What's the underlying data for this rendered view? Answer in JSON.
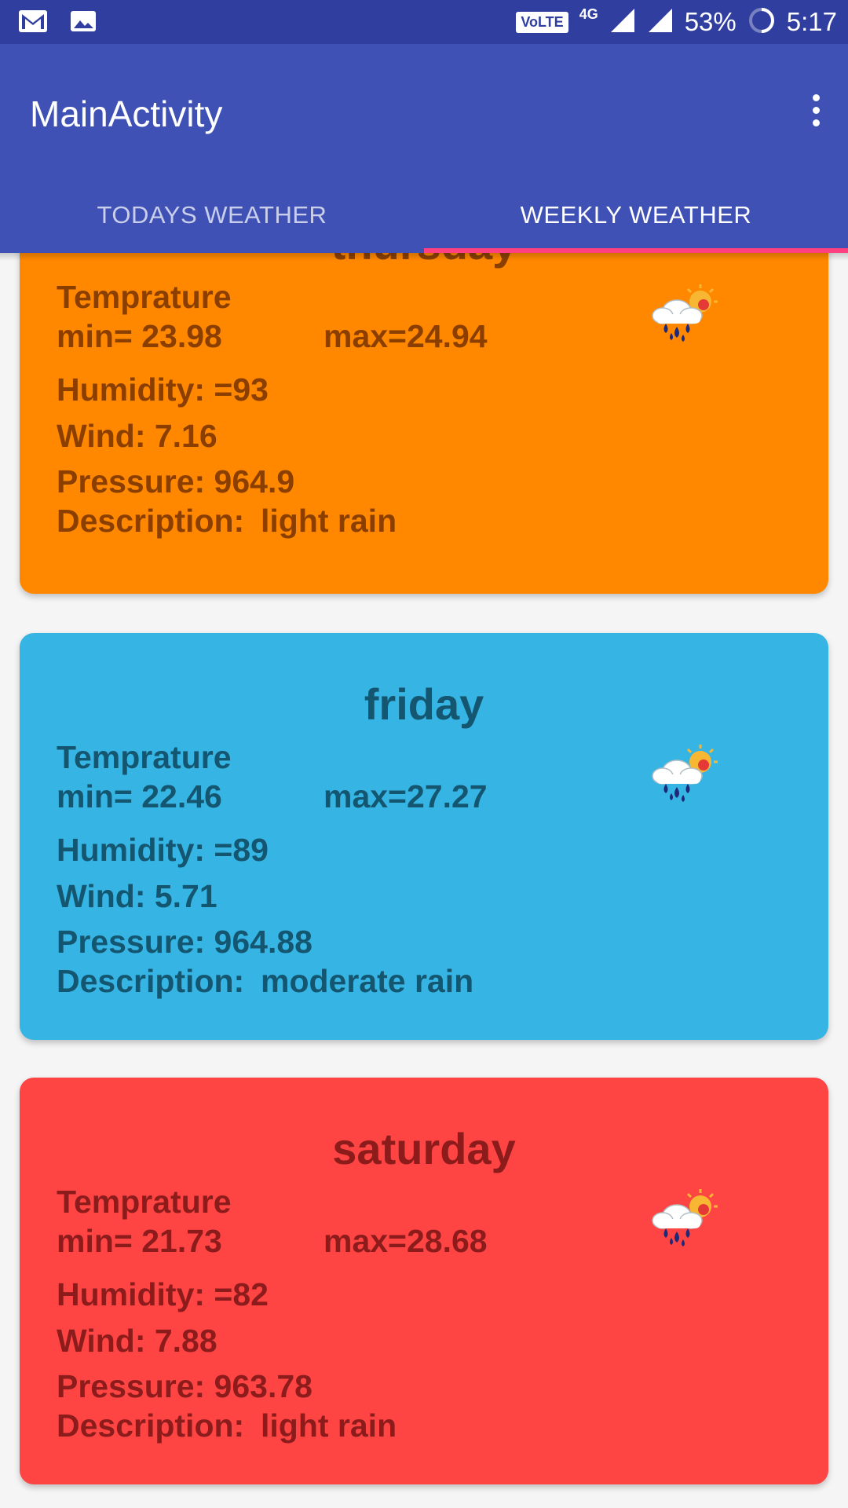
{
  "status_bar": {
    "icons": [
      "gmail-icon",
      "image-icon",
      "volte-icon",
      "signal-icon",
      "battery-ring-icon"
    ],
    "volte": "VoLTE",
    "network": "4G",
    "battery": "53%",
    "time": "5:17"
  },
  "app_bar": {
    "title": "MainActivity",
    "menu_icon": "more-vert-icon"
  },
  "tabs": [
    {
      "label": "TODAYS WEATHER",
      "selected": false
    },
    {
      "label": "WEEKLY WEATHER",
      "selected": true
    }
  ],
  "colors": {
    "status_bar": "#303F9F",
    "app_bar": "#3F51B5",
    "tab_indicator": "#FF4081"
  },
  "forecast": [
    {
      "day": "thursday",
      "temp_label": "Temprature",
      "min": "min= 23.98",
      "max": "max=24.94",
      "humidity": "Humidity: =93",
      "wind": "Wind: 7.16",
      "pressure": "Pressure: 964.9",
      "desc_label": "Description:",
      "desc_value": "light rain",
      "icon": "rain-cloud-sun-icon",
      "bg": "#FF8800",
      "fg": "#8A3F00"
    },
    {
      "day": "friday",
      "temp_label": "Temprature",
      "min": "min= 22.46",
      "max": "max=27.27",
      "humidity": "Humidity: =89",
      "wind": "Wind: 5.71",
      "pressure": "Pressure: 964.88",
      "desc_label": "Description:",
      "desc_value": "moderate rain",
      "icon": "rain-cloud-sun-icon",
      "bg": "#36B5E5",
      "fg": "#145670"
    },
    {
      "day": "saturday",
      "temp_label": "Temprature",
      "min": "min= 21.73",
      "max": "max=28.68",
      "humidity": "Humidity: =82",
      "wind": "Wind: 7.88",
      "pressure": "Pressure: 963.78",
      "desc_label": "Description:",
      "desc_value": "light rain",
      "icon": "rain-cloud-sun-icon",
      "bg": "#FF4444",
      "fg": "#8C1C1C"
    }
  ]
}
